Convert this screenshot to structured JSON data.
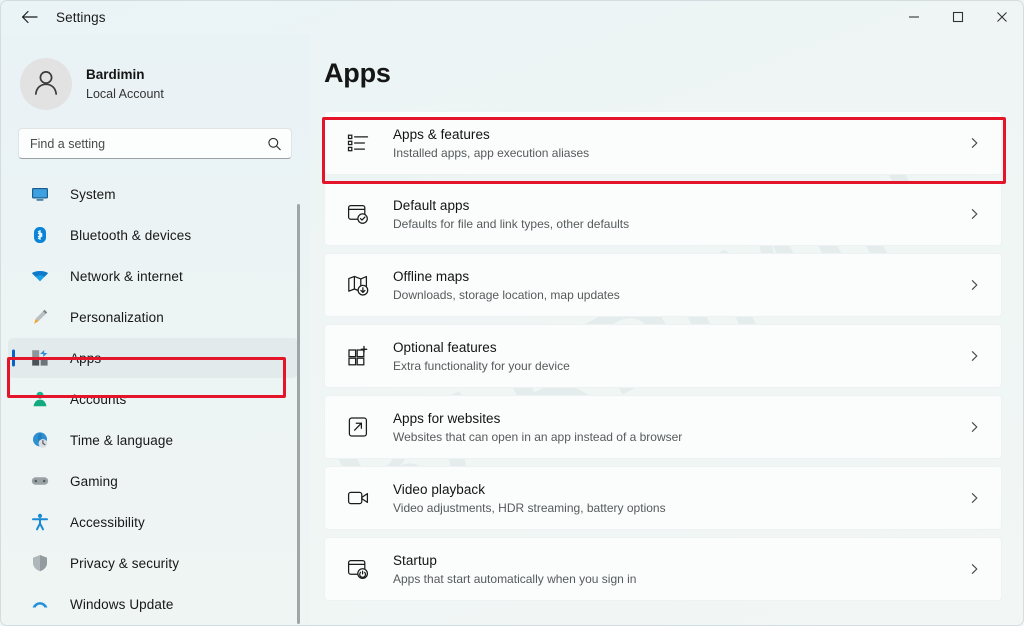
{
  "window": {
    "title": "Settings",
    "back_icon": "back-arrow-icon",
    "minimize_label": "Minimize",
    "maximize_label": "Maximize",
    "close_label": "Close"
  },
  "watermark": {
    "text": "BARDIMIN"
  },
  "profile": {
    "name": "Bardimin",
    "account_type": "Local Account",
    "avatar_icon": "user-avatar-icon"
  },
  "search": {
    "placeholder": "Find a setting",
    "value": "",
    "icon": "search-icon"
  },
  "sidebar": {
    "items": [
      {
        "label": "System",
        "icon": "monitor-icon",
        "selected": false
      },
      {
        "label": "Bluetooth & devices",
        "icon": "bluetooth-icon",
        "selected": false
      },
      {
        "label": "Network & internet",
        "icon": "wifi-icon",
        "selected": false
      },
      {
        "label": "Personalization",
        "icon": "brush-icon",
        "selected": false
      },
      {
        "label": "Apps",
        "icon": "apps-icon",
        "selected": true
      },
      {
        "label": "Accounts",
        "icon": "person-icon",
        "selected": false
      },
      {
        "label": "Time & language",
        "icon": "clock-globe-icon",
        "selected": false
      },
      {
        "label": "Gaming",
        "icon": "gamepad-icon",
        "selected": false
      },
      {
        "label": "Accessibility",
        "icon": "accessibility-icon",
        "selected": false
      },
      {
        "label": "Privacy & security",
        "icon": "shield-icon",
        "selected": false
      },
      {
        "label": "Windows Update",
        "icon": "update-icon",
        "selected": false
      }
    ]
  },
  "main": {
    "page_title": "Apps",
    "cards": [
      {
        "title": "Apps & features",
        "subtitle": "Installed apps, app execution aliases",
        "icon": "list-bullets-icon",
        "chevron": "chevron-right-icon",
        "highlighted": true
      },
      {
        "title": "Default apps",
        "subtitle": "Defaults for file and link types, other defaults",
        "icon": "window-check-icon",
        "chevron": "chevron-right-icon",
        "highlighted": false
      },
      {
        "title": "Offline maps",
        "subtitle": "Downloads, storage location, map updates",
        "icon": "map-download-icon",
        "chevron": "chevron-right-icon",
        "highlighted": false
      },
      {
        "title": "Optional features",
        "subtitle": "Extra functionality for your device",
        "icon": "grid-plus-icon",
        "chevron": "chevron-right-icon",
        "highlighted": false
      },
      {
        "title": "Apps for websites",
        "subtitle": "Websites that can open in an app instead of a browser",
        "icon": "external-link-icon",
        "chevron": "chevron-right-icon",
        "highlighted": false
      },
      {
        "title": "Video playback",
        "subtitle": "Video adjustments, HDR streaming, battery options",
        "icon": "video-camera-icon",
        "chevron": "chevron-right-icon",
        "highlighted": false
      },
      {
        "title": "Startup",
        "subtitle": "Apps that start automatically when you sign in",
        "icon": "window-power-icon",
        "chevron": "chevron-right-icon",
        "highlighted": false
      }
    ]
  },
  "annotations": {
    "color": "#e4152b",
    "sidebar_target": "Apps",
    "card_target": "Apps & features"
  },
  "colors": {
    "accent": "#0a62c6",
    "annotation_red": "#e4152b",
    "sidebar_bg": "#e9f2f5",
    "card_bg": "#fbfcfc",
    "page_bg": "#f0f6f5"
  }
}
